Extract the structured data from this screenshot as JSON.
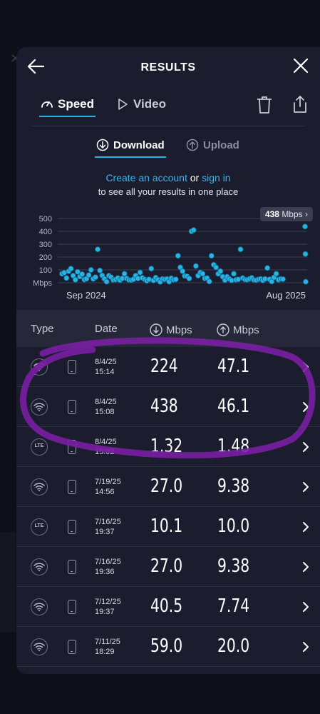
{
  "header": {
    "title": "RESULTS"
  },
  "tabs": [
    {
      "label": "Speed"
    },
    {
      "label": "Video"
    }
  ],
  "subtabs": [
    {
      "label": "Download"
    },
    {
      "label": "Upload"
    }
  ],
  "cta": {
    "create_account": "Create an account",
    "or": "or",
    "sign_in": "sign in",
    "line2": "to see all your results in one place"
  },
  "pill": {
    "value": "438",
    "unit": "Mbps",
    "arrow": "›"
  },
  "table_headers": {
    "type": "Type",
    "date": "Date",
    "down": "Mbps",
    "up": "Mbps"
  },
  "accent_color": "#25b4e6",
  "annotation_color": "#7a1fa3",
  "chart_data": {
    "type": "scatter",
    "xlabel": "",
    "ylabel": "Mbps",
    "ylim": [
      0,
      500
    ],
    "y_ticks": [
      "500",
      "400",
      "300",
      "200",
      "100",
      "Mbps"
    ],
    "x_tick_labels": [
      "Sep 2024",
      "Aug 2025"
    ],
    "grid": true,
    "points_y": [
      60,
      75,
      40,
      90,
      110,
      55,
      30,
      85,
      45,
      70,
      35,
      25,
      60,
      100,
      20,
      40,
      260,
      95,
      50,
      30,
      15,
      45,
      40,
      25,
      35,
      30,
      20,
      40,
      60,
      30,
      25,
      30,
      20,
      55,
      40,
      70,
      35,
      30,
      25,
      20,
      110,
      25,
      30,
      20,
      10,
      40,
      20,
      30,
      15,
      25,
      20,
      30,
      210,
      120,
      90,
      60,
      40,
      30,
      400,
      410,
      130,
      55,
      80,
      60,
      30,
      40,
      20,
      210,
      140,
      120,
      60,
      90,
      50,
      30,
      40,
      30,
      25,
      60,
      20,
      30,
      260,
      30,
      25,
      30,
      20,
      35,
      25,
      30,
      20,
      30,
      25,
      20,
      115,
      30,
      20,
      35,
      70,
      30,
      20,
      25,
      438,
      224,
      1.32
    ]
  },
  "rows": [
    {
      "type": "wifi",
      "date": "8/4/25",
      "time": "15:14",
      "down": "224",
      "up": "47.1"
    },
    {
      "type": "wifi",
      "date": "8/4/25",
      "time": "15:08",
      "down": "438",
      "up": "46.1"
    },
    {
      "type": "lte",
      "date": "8/4/25",
      "time": "15:02",
      "down": "1.32",
      "up": "1.48",
      "lte_label": "LTE"
    },
    {
      "type": "wifi",
      "date": "7/19/25",
      "time": "14:56",
      "down": "27.0",
      "up": "9.38"
    },
    {
      "type": "lte",
      "date": "7/16/25",
      "time": "19:37",
      "down": "10.1",
      "up": "10.0",
      "lte_label": "LTE"
    },
    {
      "type": "wifi",
      "date": "7/16/25",
      "time": "19:36",
      "down": "27.0",
      "up": "9.38"
    },
    {
      "type": "wifi",
      "date": "7/12/25",
      "time": "19:37",
      "down": "40.5",
      "up": "7.74"
    },
    {
      "type": "wifi",
      "date": "7/11/25",
      "time": "18:29",
      "down": "59.0",
      "up": "20.0"
    }
  ]
}
